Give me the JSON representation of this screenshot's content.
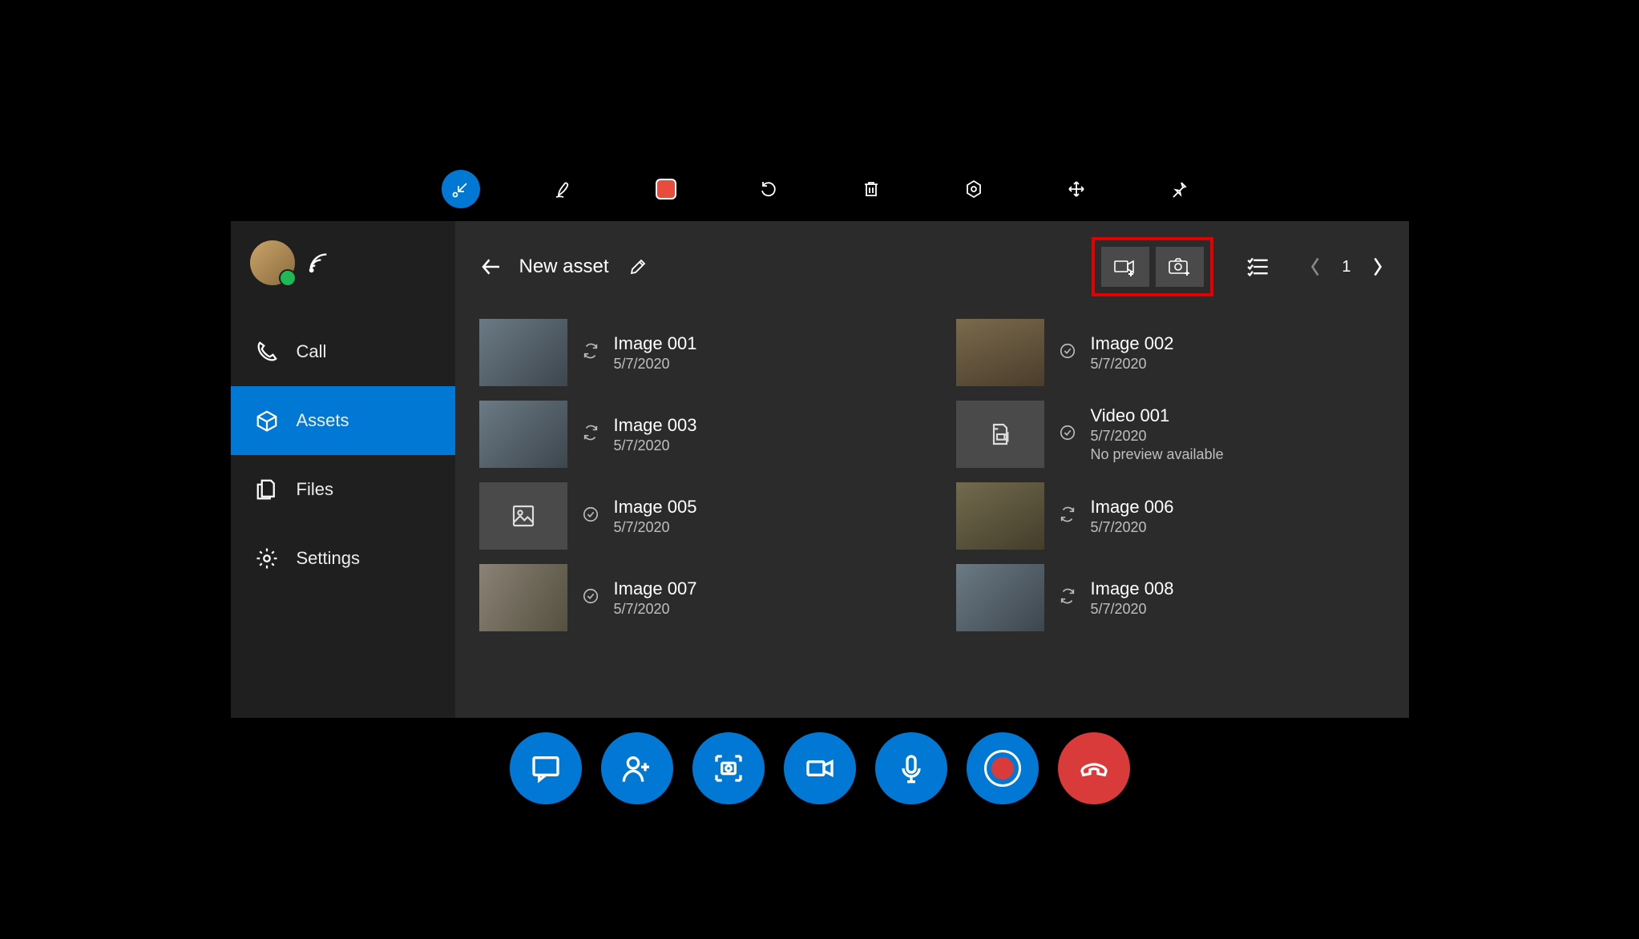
{
  "toolbar": {
    "items": [
      "collapse",
      "ink",
      "stop",
      "undo",
      "delete",
      "settings-hex",
      "move",
      "pin"
    ]
  },
  "sidebar": {
    "items": [
      {
        "id": "call",
        "label": "Call"
      },
      {
        "id": "assets",
        "label": "Assets"
      },
      {
        "id": "files",
        "label": "Files"
      },
      {
        "id": "settings",
        "label": "Settings"
      }
    ],
    "active": "assets"
  },
  "header": {
    "title": "New asset",
    "page": "1"
  },
  "assets": [
    {
      "name": "Image 001",
      "date": "5/7/2020",
      "status": "sync",
      "thumb": "industrial-a"
    },
    {
      "name": "Image 002",
      "date": "5/7/2020",
      "status": "done",
      "thumb": "industrial-b"
    },
    {
      "name": "Image 003",
      "date": "5/7/2020",
      "status": "sync",
      "thumb": "industrial-a"
    },
    {
      "name": "Video 001",
      "date": "5/7/2020",
      "status": "done",
      "thumb": "placeholder",
      "note": "No preview available",
      "placeholder": "video"
    },
    {
      "name": "Image 005",
      "date": "5/7/2020",
      "status": "done",
      "thumb": "placeholder",
      "placeholder": "image"
    },
    {
      "name": "Image 006",
      "date": "5/7/2020",
      "status": "sync",
      "thumb": "industrial-d"
    },
    {
      "name": "Image 007",
      "date": "5/7/2020",
      "status": "done",
      "thumb": "industrial-c"
    },
    {
      "name": "Image 008",
      "date": "5/7/2020",
      "status": "sync",
      "thumb": "industrial-a"
    }
  ],
  "bottombar": {
    "items": [
      "chat",
      "add-person",
      "snapshot",
      "video",
      "mic",
      "record",
      "hangup"
    ]
  }
}
